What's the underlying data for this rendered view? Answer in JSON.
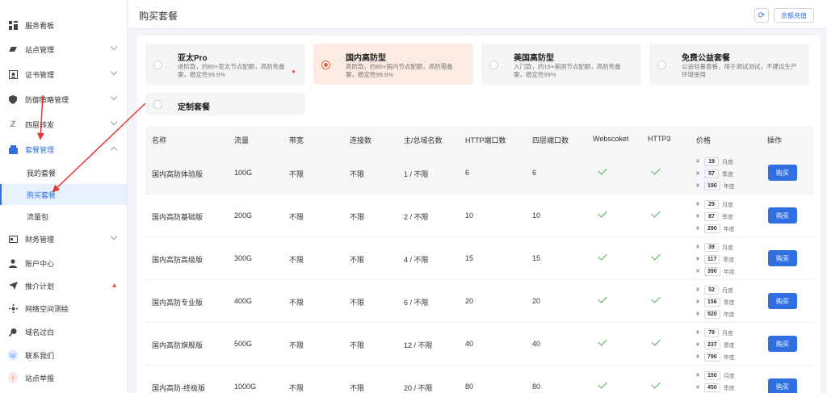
{
  "sidebar": {
    "items": [
      {
        "label": "服务看板",
        "icon": "dashboard-icon",
        "has_chevron": false
      },
      {
        "label": "站点管理",
        "icon": "site-icon",
        "has_chevron": true
      },
      {
        "label": "证书管理",
        "icon": "certificate-icon",
        "has_chevron": true
      },
      {
        "label": "防御策略管理",
        "icon": "shield-icon",
        "has_chevron": true
      },
      {
        "label": "四层转发",
        "icon": "forward-icon",
        "has_chevron": true
      },
      {
        "label": "套餐管理",
        "icon": "package-icon",
        "has_chevron": true
      },
      {
        "label": "财务管理",
        "icon": "wallet-icon",
        "has_chevron": true
      },
      {
        "label": "账户中心",
        "icon": "user-icon",
        "has_chevron": false
      },
      {
        "label": "推介计划",
        "icon": "send-icon",
        "has_chevron": false
      },
      {
        "label": "网络空间测绘",
        "icon": "network-icon",
        "has_chevron": false
      },
      {
        "label": "域名过白",
        "icon": "search-icon",
        "has_chevron": false
      },
      {
        "label": "联系我们",
        "icon": "phone-icon",
        "has_chevron": false
      },
      {
        "label": "站点举报",
        "icon": "report-icon",
        "has_chevron": false
      }
    ],
    "sub_items": [
      {
        "label": "我的套餐"
      },
      {
        "label": "购买套餐"
      },
      {
        "label": "流量包"
      }
    ]
  },
  "header": {
    "title": "购买套餐",
    "refresh_icon": "refresh-icon",
    "balance_label": "余额充值"
  },
  "plans": [
    {
      "name": "亚太Pro",
      "desc": "进阶款，约80+亚太节点配额，高防免备案，稳定性99.9%"
    },
    {
      "name": "国内高防型",
      "desc": "高防款，约80+国内节点配额，高防需备案，稳定性99.9%"
    },
    {
      "name": "美国高防型",
      "desc": "入门款，约15+美国节点配额，高防免备案，稳定性99%"
    },
    {
      "name": "免费公益套餐",
      "desc": "公益轻量套餐，用于调试测试，不建议生产环境使用"
    },
    {
      "name": "定制套餐",
      "desc": ""
    }
  ],
  "table": {
    "headers": [
      "名称",
      "流量",
      "带宽",
      "连接数",
      "主/总域名数",
      "HTTP端口数",
      "四层端口数",
      "Webscoket",
      "HTTP3",
      "价格",
      "操作"
    ],
    "price_units": [
      "月度",
      "季度",
      "年度"
    ],
    "currency": "¥",
    "buy_label": "购买",
    "rows": [
      {
        "name": "国内高防体验版",
        "traffic": "100G",
        "bandwidth": "不限",
        "connections": "不限",
        "domains": "1 / 不限",
        "http_ports": "6",
        "l4_ports": "6",
        "prices": [
          "19",
          "57",
          "190"
        ]
      },
      {
        "name": "国内高防基础版",
        "traffic": "200G",
        "bandwidth": "不限",
        "connections": "不限",
        "domains": "2 / 不限",
        "http_ports": "10",
        "l4_ports": "10",
        "prices": [
          "29",
          "87",
          "290"
        ]
      },
      {
        "name": "国内高防高级版",
        "traffic": "300G",
        "bandwidth": "不限",
        "connections": "不限",
        "domains": "4 / 不限",
        "http_ports": "15",
        "l4_ports": "15",
        "prices": [
          "39",
          "117",
          "390"
        ]
      },
      {
        "name": "国内高防专业版",
        "traffic": "400G",
        "bandwidth": "不限",
        "connections": "不限",
        "domains": "6 / 不限",
        "http_ports": "20",
        "l4_ports": "20",
        "prices": [
          "52",
          "156",
          "520"
        ]
      },
      {
        "name": "国内高防旗舰版",
        "traffic": "500G",
        "bandwidth": "不限",
        "connections": "不限",
        "domains": "12 / 不限",
        "http_ports": "40",
        "l4_ports": "40",
        "prices": [
          "79",
          "237",
          "790"
        ]
      },
      {
        "name": "国内高防-终极版",
        "traffic": "1000G",
        "bandwidth": "不限",
        "connections": "不限",
        "domains": "20 / 不限",
        "http_ports": "80",
        "l4_ports": "80",
        "prices": [
          "150",
          "450",
          ""
        ]
      }
    ]
  },
  "colors": {
    "accent": "#2f6fe0",
    "selected_card": "#fcebe2",
    "selected_radio": "#e0632f",
    "check": "#4caf50",
    "annotation": "#e53935"
  }
}
